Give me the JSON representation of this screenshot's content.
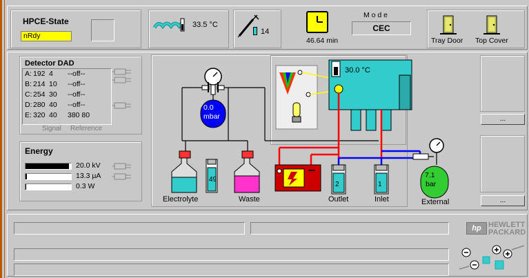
{
  "state": {
    "title": "HPCE-State",
    "value": "nRdy"
  },
  "temperature": {
    "value": "33.5 °C"
  },
  "injection": {
    "value": "14"
  },
  "time": {
    "value": "46.64 min"
  },
  "mode": {
    "title": "M o d e",
    "value": "CEC"
  },
  "doors": {
    "tray": "Tray Door",
    "cover": "Top Cover"
  },
  "detector": {
    "title": "Detector DAD",
    "rows": [
      {
        "ch": "A:",
        "wl": "192",
        "bw": "4",
        "ref": "--off--"
      },
      {
        "ch": "B:",
        "wl": "214",
        "bw": "10",
        "ref": "--off--"
      },
      {
        "ch": "C:",
        "wl": "254",
        "bw": "30",
        "ref": "--off--"
      },
      {
        "ch": "D:",
        "wl": "280",
        "bw": "40",
        "ref": "--off--"
      },
      {
        "ch": "E:",
        "wl": "320",
        "bw": "40",
        "ref": "380  80"
      }
    ],
    "footer_signal": "Signal",
    "footer_reference": "Reference"
  },
  "energy": {
    "title": "Energy",
    "rows": [
      {
        "value": "20.0 kV",
        "level": 0.95
      },
      {
        "value": "13.3 µA",
        "level": 0.03
      },
      {
        "value": "0.3 W",
        "level": 0.02
      }
    ]
  },
  "pressure": {
    "value": "0.0",
    "unit": "mbar"
  },
  "cassette_temp": {
    "value": "30.0 °C"
  },
  "vials": {
    "electrolyte": {
      "label": "Electrolyte"
    },
    "vial49": {
      "number": "49"
    },
    "waste": {
      "label": "Waste"
    },
    "outlet": {
      "label": "Outlet",
      "number": "2"
    },
    "inlet": {
      "label": "Inlet",
      "number": "1"
    },
    "external": {
      "label": "External",
      "value": "7.1",
      "unit": "bar"
    }
  },
  "buttons": {
    "more1": "...",
    "more2": "..."
  },
  "brand": {
    "line1": "HEWLETT",
    "line2": "PACKARD",
    "logo": "hp"
  },
  "colors": {
    "accent": "#ffff00",
    "teal": "#33cccc",
    "pressure": "#0000ff",
    "external": "#33cc33",
    "waste": "#ff33cc",
    "hv": "#ff0000"
  }
}
